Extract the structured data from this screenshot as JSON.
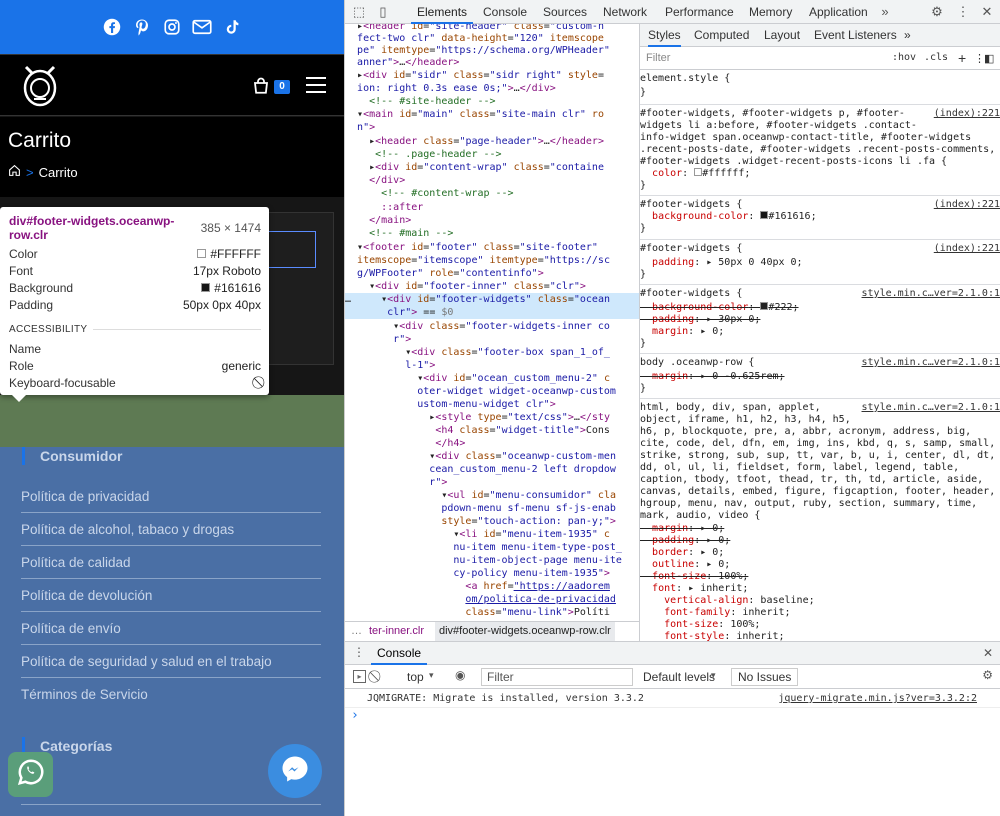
{
  "site": {
    "social_icons": [
      "facebook-icon",
      "pinterest-icon",
      "instagram-icon",
      "email-icon",
      "tiktok-icon"
    ],
    "cart_count": "0",
    "page_title": "Carrito",
    "breadcrumb_sep": ">",
    "breadcrumb_current": "Carrito",
    "widgets": [
      {
        "title": "Consumidor",
        "items": [
          "Política de privacidad",
          "Política de alcohol, tabaco y drogas",
          "Política de calidad",
          "Política de devolución",
          "Política de envío",
          "Política de seguridad y salud en el trabajo",
          "Términos de Servicio"
        ]
      },
      {
        "title": "Categorías",
        "items": []
      }
    ]
  },
  "tooltip": {
    "selector": "div#footer-widgets.oceanwp-row.clr",
    "dimensions": "385 × 1474",
    "rows": [
      {
        "key": "Color",
        "value": "#FFFFFF",
        "swatch": "#FFFFFF"
      },
      {
        "key": "Font",
        "value": "17px Roboto"
      },
      {
        "key": "Background",
        "value": "#161616",
        "swatch": "#161616"
      },
      {
        "key": "Padding",
        "value": "50px 0px 40px"
      }
    ],
    "accessibility_header": "ACCESSIBILITY",
    "acc_rows": [
      {
        "key": "Name",
        "value": ""
      },
      {
        "key": "Role",
        "value": "generic"
      },
      {
        "key": "Keyboard-focusable",
        "value": "⃠"
      }
    ]
  },
  "devtools": {
    "tabs": [
      "Elements",
      "Console",
      "Sources",
      "Network",
      "Performance",
      "Memory",
      "Application"
    ],
    "active_tab": "Elements",
    "styles_tabs": [
      "Styles",
      "Computed",
      "Layout",
      "Event Listeners"
    ],
    "filter_placeholder": "Filter",
    "hov": ":hov",
    "cls": ".cls",
    "crumbs": [
      "ter-inner.clr",
      "div#footer-widgets.oceanwp-row.clr"
    ],
    "console_tab": "Console",
    "console_context": "top",
    "console_filter": "Filter",
    "default_levels": "Default levels",
    "no_issues": "No Issues",
    "console_message": "JQMIGRATE: Migrate is installed, version 3.3.2",
    "console_source": "jquery-migrate.min.js?ver=3.3.2:2",
    "prompt": "›"
  },
  "colors": {
    "accent": "#1a73e8",
    "footer_bg": "#161616",
    "widget_bg": "#4a6fa5",
    "tag": "#881280"
  }
}
